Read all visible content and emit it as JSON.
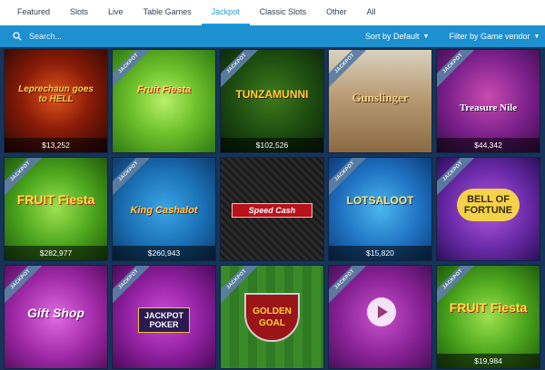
{
  "tabs": [
    {
      "label": "Featured"
    },
    {
      "label": "Slots"
    },
    {
      "label": "Live"
    },
    {
      "label": "Table Games"
    },
    {
      "label": "Jackpot",
      "active": true
    },
    {
      "label": "Classic Slots"
    },
    {
      "label": "Other"
    },
    {
      "label": "All"
    }
  ],
  "toolbar": {
    "search_placeholder": "Search...",
    "sort_label": "Sort by Default",
    "filter_label": "Filter by Game vendor"
  },
  "colors": {
    "accent": "#1d90d0",
    "ribbon": "#5b7da3"
  },
  "games": [
    {
      "title": "Leprechaun goes to HELL",
      "amount": "$13,252",
      "ribbon": ""
    },
    {
      "title": "Fruit Fiesta",
      "amount": "",
      "ribbon": "JACKPOT"
    },
    {
      "title": "TUNZAMUNNI",
      "amount": "$102,526",
      "ribbon": "JACKPOT"
    },
    {
      "title": "Gunslinger",
      "amount": "",
      "ribbon": "JACKPOT"
    },
    {
      "title": "Treasure Nile",
      "amount": "$44,342",
      "ribbon": "JACKPOT"
    },
    {
      "title": "FRUIT Fiesta",
      "amount": "$282,977",
      "ribbon": "JACKPOT"
    },
    {
      "title": "King Cashalot",
      "amount": "$260,943",
      "ribbon": "JACKPOT"
    },
    {
      "title": "Speed Cash",
      "amount": "",
      "ribbon": ""
    },
    {
      "title": "LOTSALOOT",
      "amount": "$15,820",
      "ribbon": "JACKPOT"
    },
    {
      "title": "BELL OF FORTUNE",
      "amount": "",
      "ribbon": "JACKPOT"
    },
    {
      "title": "Gift Shop",
      "amount": "",
      "ribbon": "JACKPOT"
    },
    {
      "title": "JACKPOT POKER",
      "amount": "",
      "ribbon": "JACKPOT"
    },
    {
      "title": "GOLDEN GOAL",
      "amount": "",
      "ribbon": "JACKPOT"
    },
    {
      "title": "",
      "amount": "",
      "ribbon": "JACKPOT"
    },
    {
      "title": "FRUIT Fiesta",
      "amount": "$19,984",
      "ribbon": "JACKPOT"
    }
  ]
}
